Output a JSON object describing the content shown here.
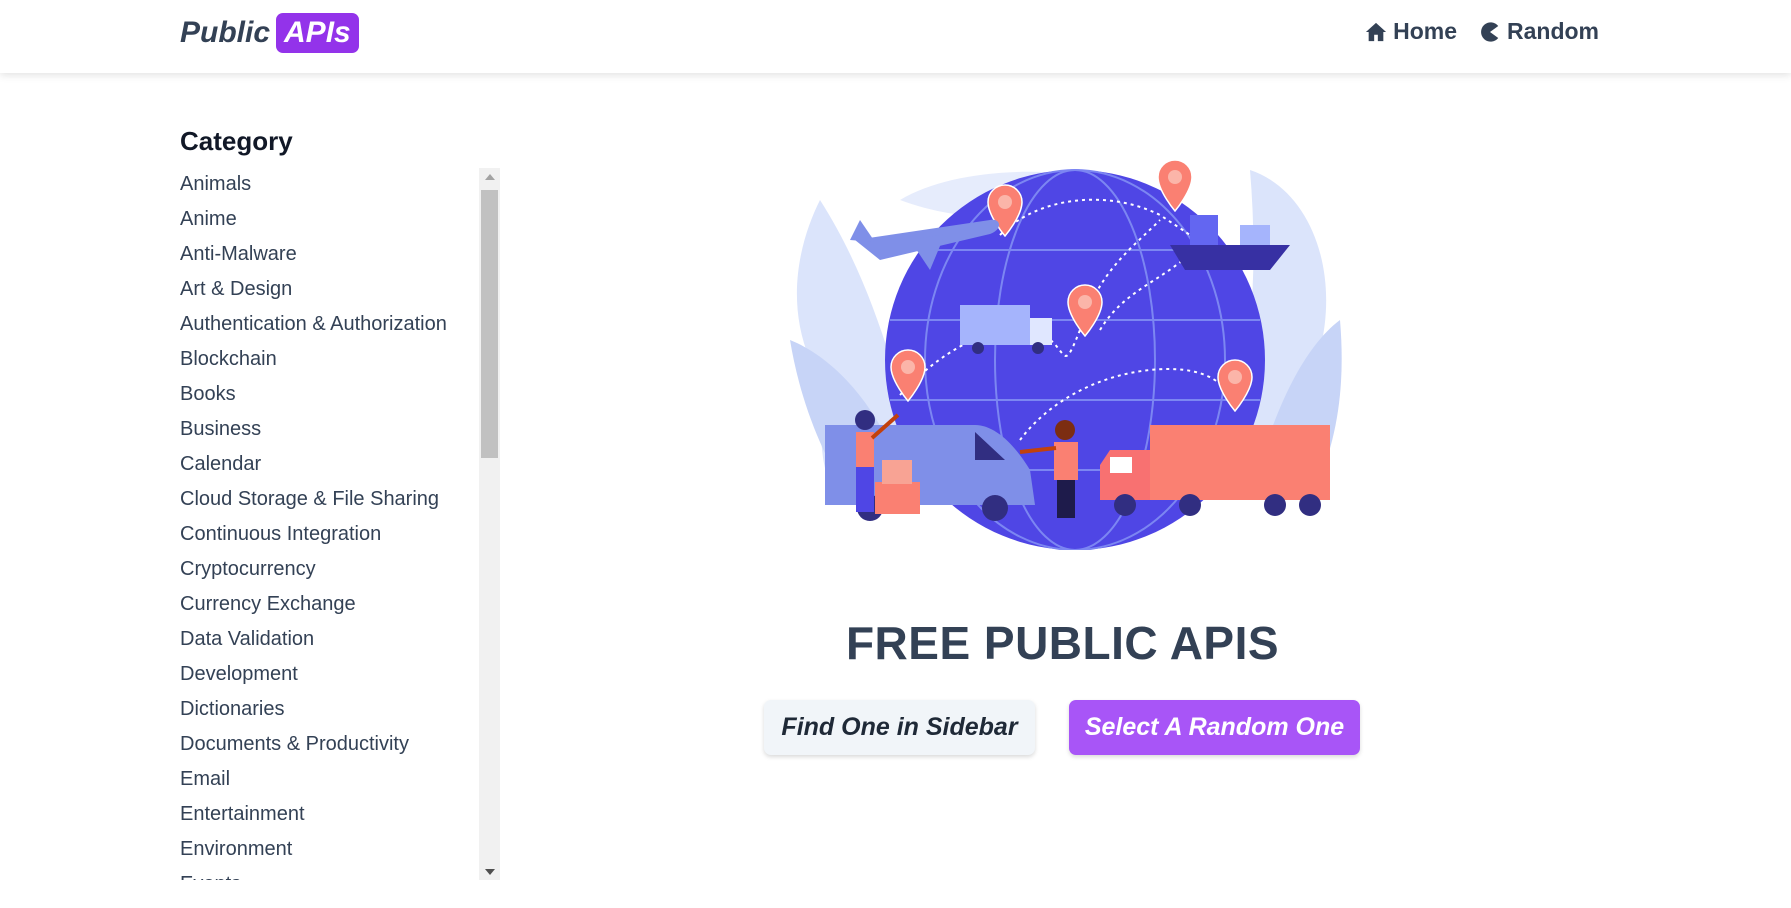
{
  "header": {
    "logo_text": "Public",
    "logo_badge": "APIs",
    "nav": [
      {
        "label": "Home",
        "icon": "home-icon"
      },
      {
        "label": "Random",
        "icon": "pacman-icon"
      }
    ]
  },
  "sidebar": {
    "title": "Category",
    "items": [
      "Animals",
      "Anime",
      "Anti-Malware",
      "Art & Design",
      "Authentication & Authorization",
      "Blockchain",
      "Books",
      "Business",
      "Calendar",
      "Cloud Storage & File Sharing",
      "Continuous Integration",
      "Cryptocurrency",
      "Currency Exchange",
      "Data Validation",
      "Development",
      "Dictionaries",
      "Documents & Productivity",
      "Email",
      "Entertainment",
      "Environment",
      "Events"
    ]
  },
  "main": {
    "title": "FREE PUBLIC APIS",
    "find_button": "Find One in Sidebar",
    "random_button": "Select A Random One",
    "illustration": "global-logistics-illustration"
  },
  "colors": {
    "brand_purple": "#9333ea",
    "button_purple": "#a855f7",
    "text_dark": "#334155",
    "globe_blue": "#4f46e5",
    "coral": "#fa8072"
  }
}
